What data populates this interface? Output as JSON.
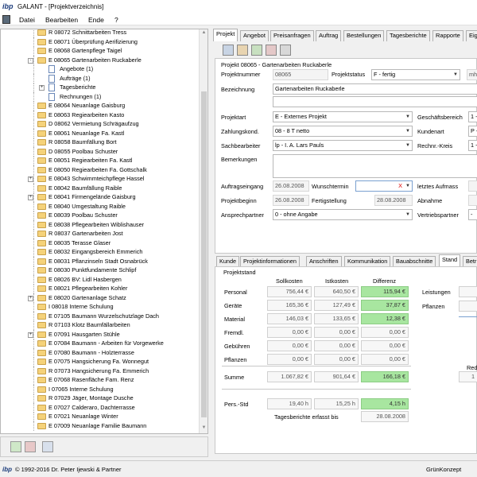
{
  "window": {
    "logo": "ibp",
    "title": "GALANT - [Projektverzeichnis]"
  },
  "menu": {
    "items": [
      "Datei",
      "Bearbeiten",
      "Ende",
      "?"
    ]
  },
  "tree": {
    "items": [
      {
        "label": "R 08072 Schnittarbeiten Tress",
        "indent": 1,
        "type": "folder"
      },
      {
        "label": "E 08071 Überprüfung Aerifizierung",
        "indent": 1,
        "type": "folder"
      },
      {
        "label": "E 08068 Gartenpflege Taigel",
        "indent": 1,
        "type": "folder"
      },
      {
        "label": "E 08065 Gartenarbeiten Ruckaberle",
        "indent": 1,
        "type": "folder-open",
        "expander": "-"
      },
      {
        "label": "Angebote (1)",
        "indent": 2,
        "type": "doc"
      },
      {
        "label": "Aufträge (1)",
        "indent": 2,
        "type": "doc"
      },
      {
        "label": "Tagesberichte",
        "indent": 2,
        "type": "doc",
        "expander": "+"
      },
      {
        "label": "Rechnungen (1)",
        "indent": 2,
        "type": "doc"
      },
      {
        "label": "E 08064 Neuanlage Gaisburg",
        "indent": 1,
        "type": "folder"
      },
      {
        "label": "E 08063 Regiearbeiten Kasto",
        "indent": 1,
        "type": "folder"
      },
      {
        "label": "D 08062 Vermietung Schrägaufzug",
        "indent": 1,
        "type": "folder"
      },
      {
        "label": "E 08061 Neuanlage Fa. Kastl",
        "indent": 1,
        "type": "folder"
      },
      {
        "label": "R 08058 Baumfällung Bort",
        "indent": 1,
        "type": "folder"
      },
      {
        "label": "D 08055 Poolbau Schuster",
        "indent": 1,
        "type": "folder"
      },
      {
        "label": "E 08051 Regiearbeiten Fa. Kastl",
        "indent": 1,
        "type": "folder"
      },
      {
        "label": "E 08050 Regiearbeiten Fa. Gottschalk",
        "indent": 1,
        "type": "folder"
      },
      {
        "label": "E 08043 Schwimmteichpflege Hassel",
        "indent": 1,
        "type": "folder",
        "expander": "+"
      },
      {
        "label": "E 08042 Baumfällung Raible",
        "indent": 1,
        "type": "folder"
      },
      {
        "label": "E 08041 Firmengelände Gaisburg",
        "indent": 1,
        "type": "folder",
        "expander": "+"
      },
      {
        "label": "E 08040 Umgestaltung Raible",
        "indent": 1,
        "type": "folder"
      },
      {
        "label": "E 08039 Poolbau Schuster",
        "indent": 1,
        "type": "folder"
      },
      {
        "label": "E 08038 Pflegearbeiten Wiblishauser",
        "indent": 1,
        "type": "folder"
      },
      {
        "label": "R 08037 Gartenarbeiten Jost",
        "indent": 1,
        "type": "folder"
      },
      {
        "label": "E 08035 Terasse Glaser",
        "indent": 1,
        "type": "folder"
      },
      {
        "label": "E 08032 Eingangsbereich Emmerich",
        "indent": 1,
        "type": "folder"
      },
      {
        "label": "E 08031 Pflanzinseln Stadt Osnabrück",
        "indent": 1,
        "type": "folder"
      },
      {
        "label": "E 08030 Punktfundamente Schlipf",
        "indent": 1,
        "type": "folder"
      },
      {
        "label": "E 08026 BV: Lidl Hasbergen",
        "indent": 1,
        "type": "folder"
      },
      {
        "label": "E 08021 Pflegearbeiten Kohler",
        "indent": 1,
        "type": "folder"
      },
      {
        "label": "E 08020 Gartenanlage Schatz",
        "indent": 1,
        "type": "folder",
        "expander": "+"
      },
      {
        "label": "I 08018 Interne Schulung",
        "indent": 1,
        "type": "folder"
      },
      {
        "label": "E 07105 Baumann Wurzelschutzlage Dach",
        "indent": 1,
        "type": "folder"
      },
      {
        "label": "R 07103 Klotz Baumfällarbeiten",
        "indent": 1,
        "type": "folder"
      },
      {
        "label": "E 07091 Hausgarten Stühle",
        "indent": 1,
        "type": "folder",
        "expander": "+"
      },
      {
        "label": "E 07084 Baumann - Arbeiten für Vorgewerke",
        "indent": 1,
        "type": "folder"
      },
      {
        "label": "E 07080 Baumann - Holzterrasse",
        "indent": 1,
        "type": "folder"
      },
      {
        "label": "E 07075 Hangsicherung Fa. Wonnegut",
        "indent": 1,
        "type": "folder"
      },
      {
        "label": "R 07073 Hangsicherung Fa. Emmerich",
        "indent": 1,
        "type": "folder"
      },
      {
        "label": "E 07068 Rasenfläche Fam. Renz",
        "indent": 1,
        "type": "folder"
      },
      {
        "label": "I 07065 Interne Schulung",
        "indent": 1,
        "type": "folder"
      },
      {
        "label": "R 07029 Jäger, Montage Dusche",
        "indent": 1,
        "type": "folder"
      },
      {
        "label": "E 07027 Calderaro, Dachterrasse",
        "indent": 1,
        "type": "folder"
      },
      {
        "label": "E 07021 Neuanlage Winter",
        "indent": 1,
        "type": "folder"
      },
      {
        "label": "E 07009 Neuanlage Familie Baumann",
        "indent": 1,
        "type": "folder"
      }
    ]
  },
  "tabs": [
    "Projekt",
    "Angebot",
    "Preisanfragen",
    "Auftrag",
    "Bestellungen",
    "Tagesberichte",
    "Rapporte",
    "Eig"
  ],
  "form": {
    "header": "Projekt 08065 - Gartenarbeiten Ruckaberle",
    "projektnummer_label": "Projektnummer",
    "projektnummer": "08065",
    "projektstatus_label": "Projektstatus",
    "projektstatus": "F - fertig",
    "mh": "mh",
    "bezeichnung_label": "Bezeichnung",
    "bezeichnung": "Gartenarbeiten Ruckaberle",
    "projektart_label": "Projektart",
    "projektart": "E - Externes Projekt",
    "geschaeftsbereich_label": "Geschäftsbereich",
    "geschaeftsbereich": "1 -",
    "zahlungskond_label": "Zahlungskond.",
    "zahlungskond": "08 - 8 T netto",
    "kundenart_label": "Kundenart",
    "kundenart": "P -",
    "sachbearbeiter_label": "Sachbearbeiter",
    "sachbearbeiter": "lp - I. A. Lars Pauls",
    "rechnkreis_label": "Rechnr.-Kreis",
    "rechnkreis": "1 -",
    "bemerkungen_label": "Bemerkungen",
    "auftragseingang_label": "Auftragseingang",
    "auftragseingang": "26.08.2008",
    "wunschtermin_label": "Wunschtermin",
    "wunschtermin_x": "X",
    "letztes_aufmass_label": "letztes Aufmass",
    "projektbeginn_label": "Projektbeginn",
    "projektbeginn": "26.08.2008",
    "fertigstellung_label": "Fertigstellung",
    "fertigstellung": "28.08.2008",
    "abnahme_label": "Abnahme",
    "ansprechpartner_label": "Ansprechpartner",
    "ansprechpartner": "0 - ohne Angabe",
    "vertriebspartner_label": "Vertriebspartner",
    "vertriebspartner": "-"
  },
  "subtabs": [
    "Kunde",
    "Projektinformationen",
    "Anschriften",
    "Kommunikation",
    "Bauabschnitte",
    "Stand",
    "Betr"
  ],
  "stand": {
    "title": "Projektstand",
    "headers": [
      "Sollkosten",
      "Istkosten",
      "Differenz"
    ],
    "rows": [
      {
        "label": "Personal",
        "soll": "756,44 €",
        "ist": "640,50 €",
        "diff": "115,94 €",
        "green": true
      },
      {
        "label": "Geräte",
        "soll": "165,36 €",
        "ist": "127,49 €",
        "diff": "37,87 €",
        "green": true
      },
      {
        "label": "Material",
        "soll": "146,03 €",
        "ist": "133,65 €",
        "diff": "12,38 €",
        "green": true
      },
      {
        "label": "Fremdl.",
        "soll": "0,00 €",
        "ist": "0,00 €",
        "diff": "0,00 €",
        "green": false
      },
      {
        "label": "Gebühren",
        "soll": "0,00 €",
        "ist": "0,00 €",
        "diff": "0,00 €",
        "green": false
      },
      {
        "label": "Pflanzen",
        "soll": "0,00 €",
        "ist": "0,00 €",
        "diff": "0,00 €",
        "green": false
      }
    ],
    "summe": {
      "label": "Summe",
      "soll": "1.067,82 €",
      "ist": "901,64 €",
      "diff": "166,18 €"
    },
    "pers": {
      "label": "Pers.-Std",
      "soll": "19,40 h",
      "ist": "15,25 h",
      "diff": "4,15 h"
    },
    "tagesberichte_label": "Tagesberichte erfasst bis",
    "tagesberichte_date": "28.08.2008",
    "right_labels": [
      "Leistungen",
      "Pflanzen"
    ],
    "red_label": "Red",
    "red_val": "1"
  },
  "status": {
    "copyright": "© 1992-2016 Dr. Peter Ijewski & Partner",
    "right": "GrünKonzept"
  },
  "colors": {
    "accent_green": "#a8e6a0",
    "folder": "#f5d27a"
  }
}
